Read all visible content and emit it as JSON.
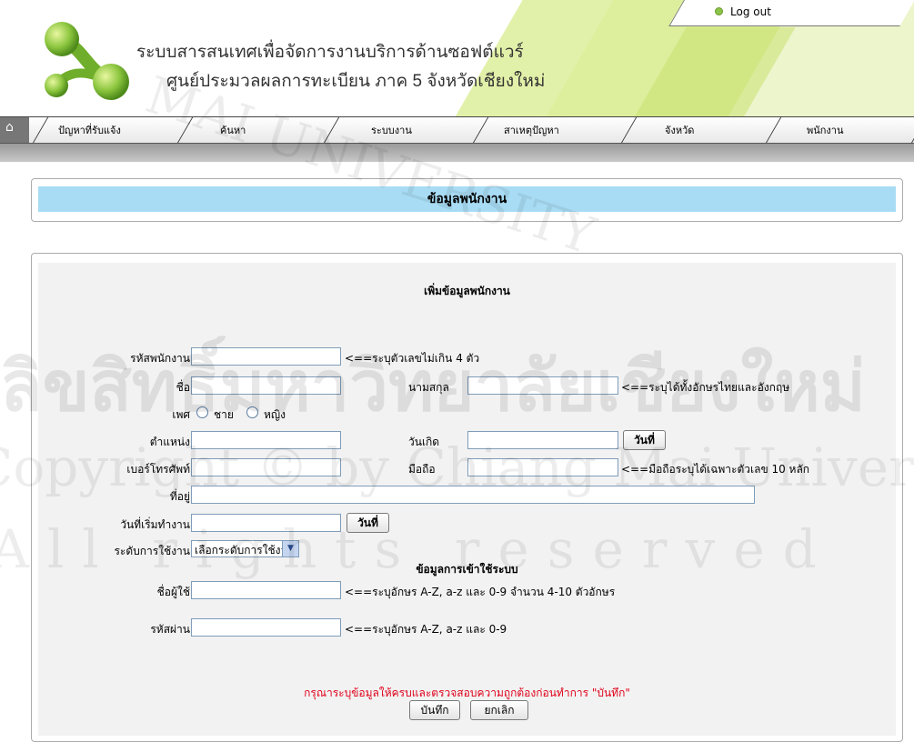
{
  "header": {
    "title_line1": "ระบบสารสนเทศเพื่อจัดการงานบริการด้านซอฟต์แวร์",
    "title_line2": "ศูนย์ประมวลผลการทะเบียน ภาค 5 จังหวัดเชียงใหม่",
    "logout_label": "Log out"
  },
  "nav": {
    "home_icon": "home-icon",
    "items": [
      "ปัญหาที่รับแจ้ง",
      "ค้นหา",
      "ระบบงาน",
      "สาเหตุปัญหา",
      "จังหวัด",
      "พนักงาน"
    ]
  },
  "page_title": "ข้อมูลพนักงาน",
  "form": {
    "heading": "เพิ่มข้อมูลพนักงาน",
    "employee_id_label": "รหัสพนักงาน",
    "employee_id_hint": "<==ระบุตัวเลขไม่เกิน 4 ตัว",
    "first_name_label": "ชื่อ",
    "last_name_label": "นามสกุล",
    "name_hint": "<==ระบุได้ทั้งอักษรไทยและอังกฤษ",
    "gender_label": "เพศ",
    "gender_male": "ชาย",
    "gender_female": "หญิง",
    "position_label": "ตำแหน่ง",
    "birthdate_label": "วันเกิด",
    "date_button": "วันที่",
    "phone_label": "เบอร์โทรศัพท์",
    "mobile_label": "มือถือ",
    "mobile_hint": "<==มือถือระบุได้เฉพาะตัวเลข 10 หลัก",
    "address_label": "ที่อยู่",
    "start_date_label": "วันที่เริ่มทำงาน",
    "access_level_label": "ระดับการใช้งาน",
    "access_level_selected": "เลือกระดับการใช้งาน",
    "login_section": "ข้อมูลการเข้าใช้ระบบ",
    "username_label": "ชื่อผู้ใช้",
    "username_hint": "<==ระบุอักษร A-Z, a-z และ 0-9 จำนวน 4-10 ตัวอักษร",
    "password_label": "รหัสผ่าน",
    "password_hint": "<==ระบุอักษร A-Z, a-z และ 0-9",
    "warning": "กรุณาระบุข้อมูลให้ครบและตรวจสอบความถูกต้องก่อนทำการ \"บันทึก\"",
    "save_button": "บันทึก",
    "cancel_button": "ยกเลิก"
  },
  "watermark": {
    "arc_text": "MAI UNIVERSITY",
    "thai": "ลิขสิทธิ์มหาวิทยาลัยเชียงใหม่",
    "copyright": "Copyright © by Chiang Mai University",
    "rights": "All rights reserved"
  },
  "colors": {
    "title_bar": "#a8dcf4",
    "warning_text": "#e0001a",
    "header_green": "#d8ec8c"
  }
}
